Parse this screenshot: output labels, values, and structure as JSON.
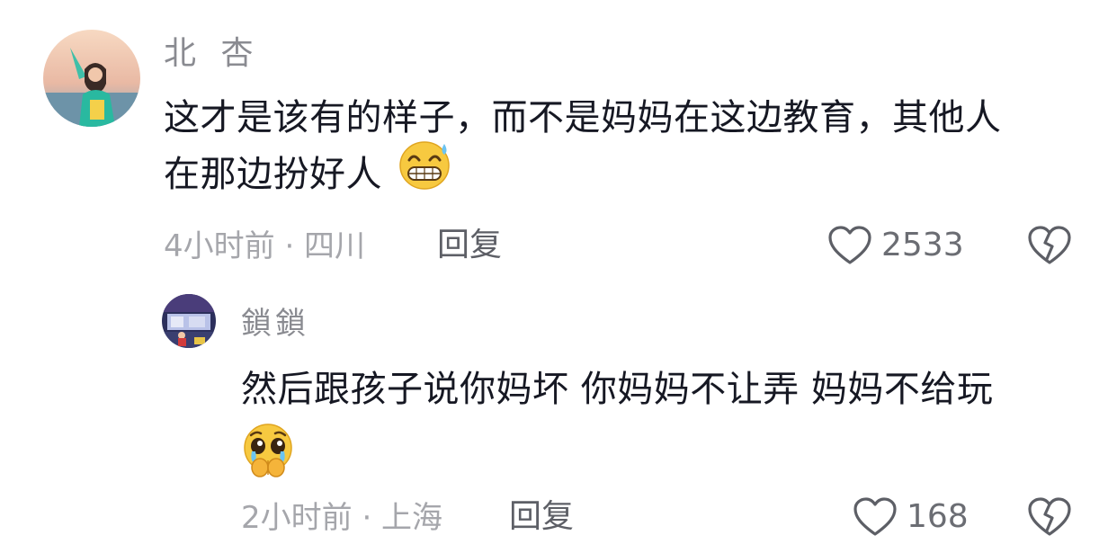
{
  "comments": [
    {
      "username": "北 杏",
      "text_line1": "这才是该有的样子，而不是妈妈在这边教育，其他人",
      "text_line2": "在那边扮好人",
      "emoji": "grinning-sweat-emoji",
      "time_location": "4小时前 · 四川",
      "reply_label": "回复",
      "likes": "2533"
    },
    {
      "username": "鎖鎖",
      "text_line1": "然后跟孩子说你妈坏 你妈妈不让弄 妈妈不给玩",
      "emoji": "pleading-face-emoji",
      "time_location": "2小时前 · 上海",
      "reply_label": "回复",
      "likes": "168"
    }
  ],
  "icons": {
    "like": "heart-outline-icon",
    "dislike": "broken-heart-icon"
  },
  "colors": {
    "text": "#161823",
    "username": "#8a8b91",
    "meta": "#a5a6ab",
    "icon": "#5d5f66"
  }
}
